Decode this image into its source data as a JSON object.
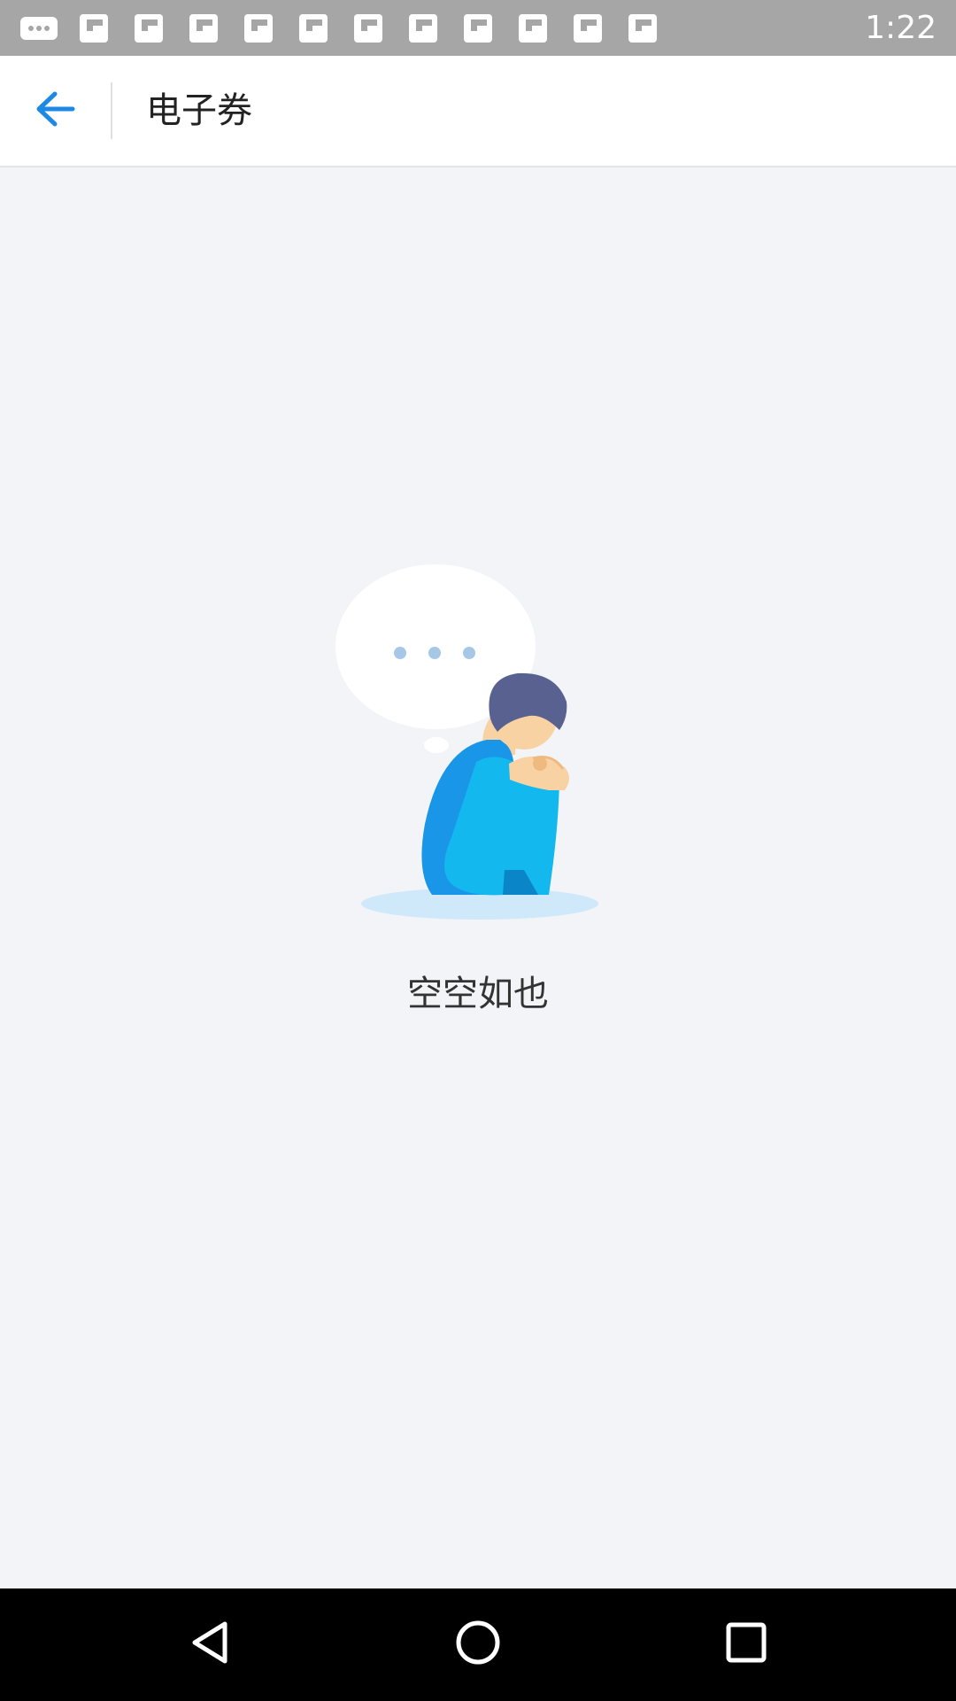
{
  "status_bar": {
    "time": "1:22",
    "icons": [
      "more-icon",
      "flipboard-icon",
      "flipboard-icon",
      "flipboard-icon",
      "flipboard-icon",
      "flipboard-icon",
      "flipboard-icon",
      "flipboard-icon",
      "flipboard-icon",
      "flipboard-icon",
      "flipboard-icon",
      "flipboard-icon"
    ]
  },
  "header": {
    "back_icon": "arrow-left-icon",
    "title": "电子券"
  },
  "empty_state": {
    "illustration": "sad-person-thinking-illustration",
    "message": "空空如也"
  },
  "nav_bar": {
    "buttons": [
      "back-triangle-icon",
      "home-circle-icon",
      "recents-square-icon"
    ]
  },
  "colors": {
    "accent": "#1e88e5",
    "background": "#f3f4f8",
    "status_bar": "#a6a6a6",
    "shirt": "#1a96e8",
    "pants": "#12b8ee",
    "hair": "#58618f",
    "skin": "#f8d2a2",
    "bubble": "#ffffff",
    "bubble_dots": "#a6c8e6"
  }
}
